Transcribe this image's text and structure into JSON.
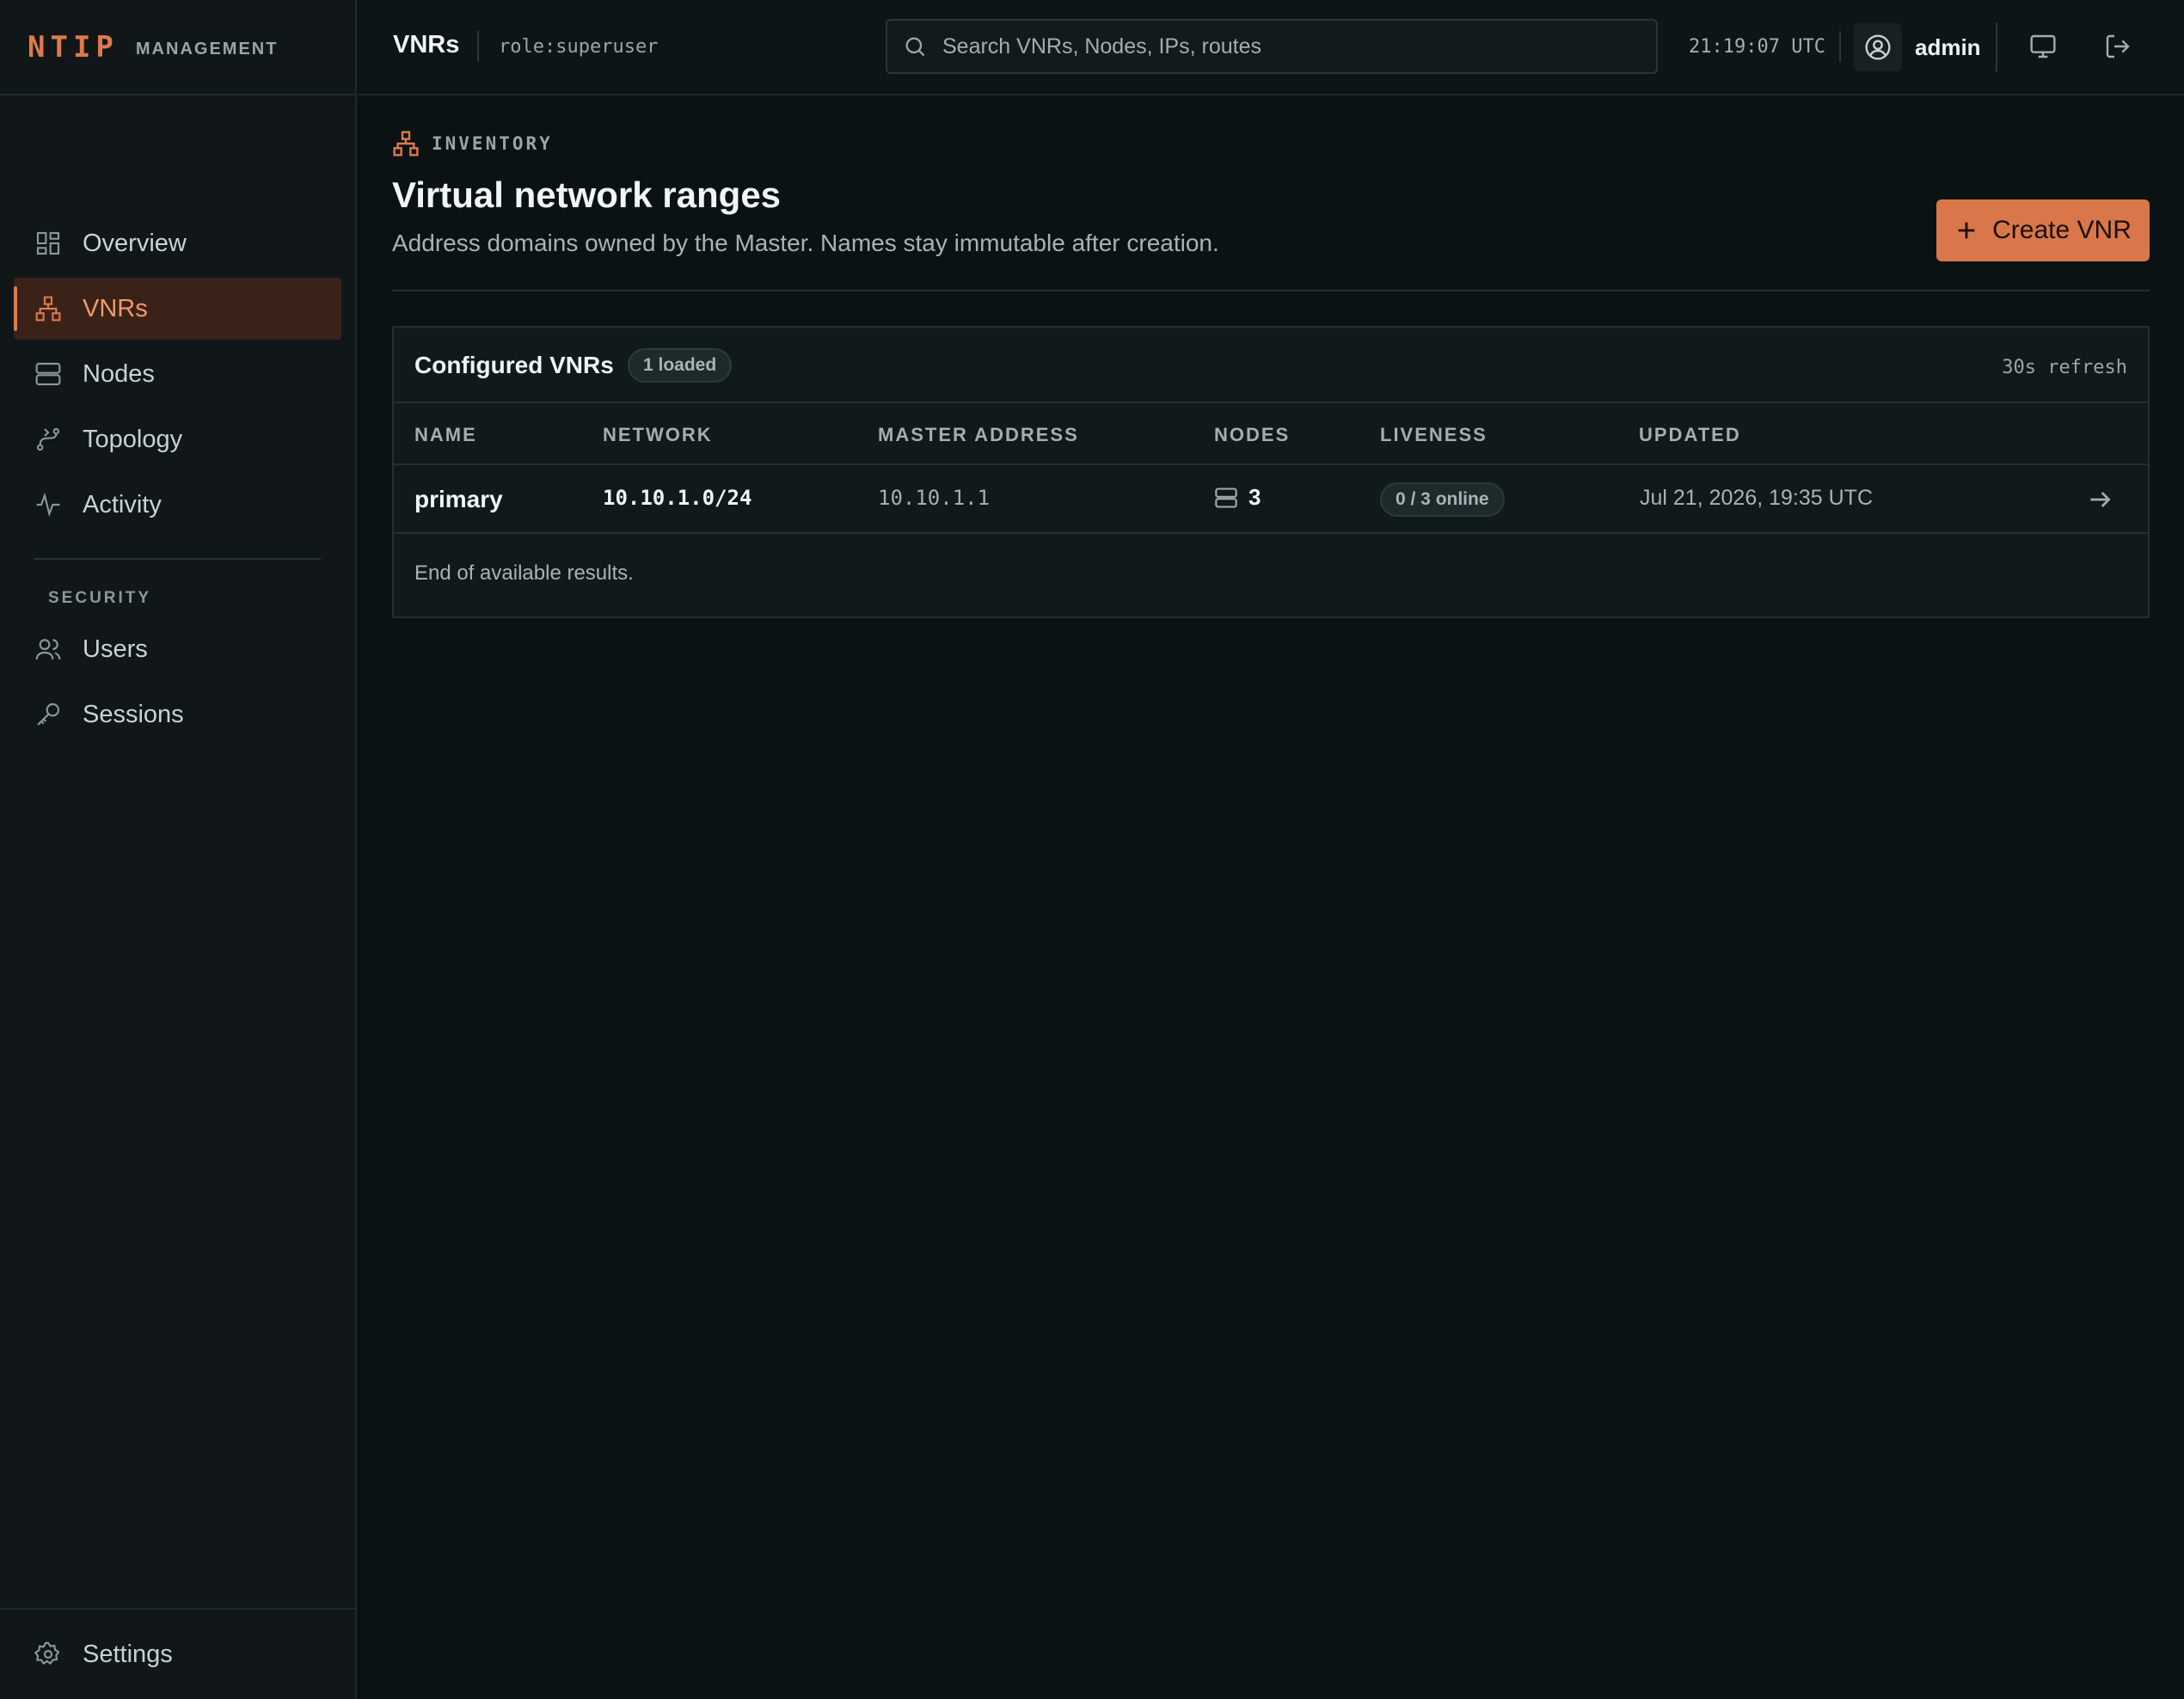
{
  "brand": {
    "name": "NTIP",
    "subtitle": "MANAGEMENT"
  },
  "sidebar": {
    "items": [
      {
        "label": "Overview",
        "icon": "grid-icon"
      },
      {
        "label": "VNRs",
        "icon": "network-icon",
        "active": true
      },
      {
        "label": "Nodes",
        "icon": "server-icon"
      },
      {
        "label": "Topology",
        "icon": "topology-icon"
      },
      {
        "label": "Activity",
        "icon": "activity-icon"
      }
    ],
    "security_label": "SECURITY",
    "security_items": [
      {
        "label": "Users",
        "icon": "users-icon"
      },
      {
        "label": "Sessions",
        "icon": "key-icon"
      }
    ],
    "footer": {
      "label": "Settings",
      "icon": "gear-icon"
    }
  },
  "topbar": {
    "title": "VNRs",
    "role": "role:superuser",
    "search_placeholder": "Search VNRs, Nodes, IPs, routes",
    "clock": "21:19:07 UTC",
    "user": "admin"
  },
  "page": {
    "eyebrow": "INVENTORY",
    "title": "Virtual network ranges",
    "subtitle": "Address domains owned by the Master. Names stay immutable after creation.",
    "create_button": "Create VNR"
  },
  "table": {
    "title": "Configured VNRs",
    "badge": "1 loaded",
    "refresh": "30s refresh",
    "columns": [
      "NAME",
      "NETWORK",
      "MASTER ADDRESS",
      "NODES",
      "LIVENESS",
      "UPDATED"
    ],
    "rows": [
      {
        "name": "primary",
        "network": "10.10.1.0/24",
        "master_address": "10.10.1.1",
        "nodes": "3",
        "liveness": "0 / 3 online",
        "updated": "Jul 21, 2026, 19:35 UTC"
      }
    ],
    "footer": "End of available results."
  },
  "colors": {
    "accent": "#e07a4a",
    "background": "#0a1214",
    "sidebar": "#111719"
  }
}
